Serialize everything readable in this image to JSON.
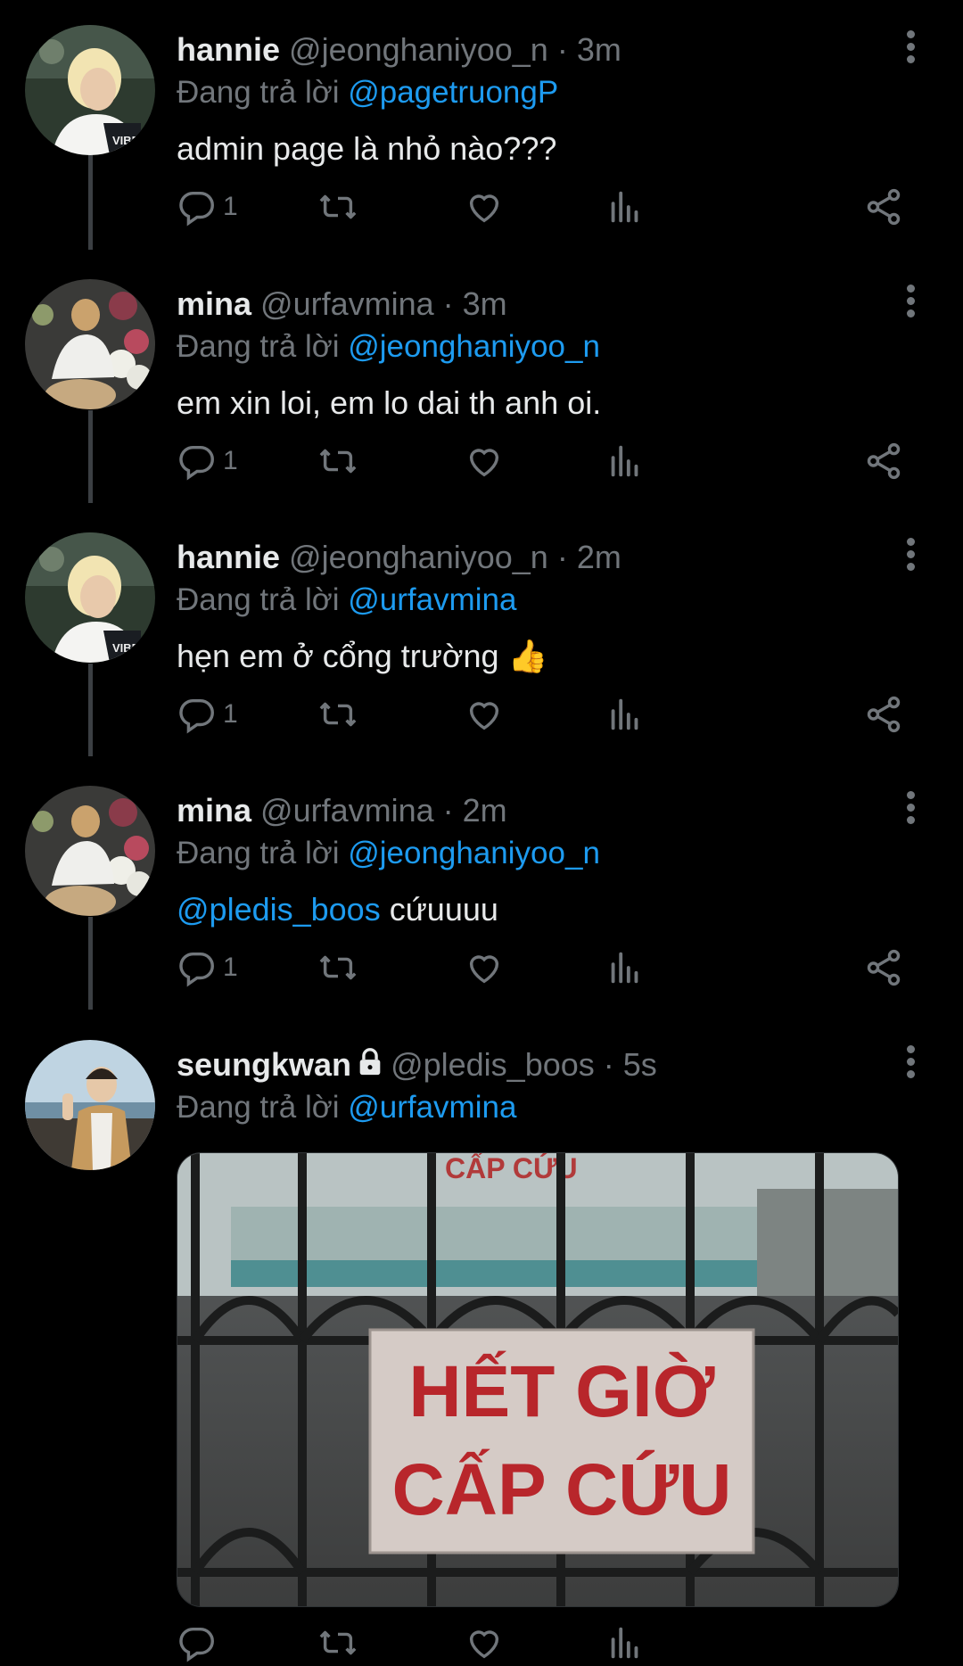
{
  "tweets": [
    {
      "name": "hannie",
      "handle": "@jeonghaniyoo_n",
      "time": "· 3m",
      "reply_prefix": "Đang trả lời",
      "reply_to": "@pagetruongP",
      "text": "admin page là nhỏ nào???",
      "replies": "1"
    },
    {
      "name": "mina",
      "handle": "@urfavmina",
      "time": "· 3m",
      "reply_prefix": "Đang trả lời",
      "reply_to": "@jeonghaniyoo_n",
      "text": "em xin loi, em lo dai th anh oi.",
      "replies": "1"
    },
    {
      "name": "hannie",
      "handle": "@jeonghaniyoo_n",
      "time": "· 2m",
      "reply_prefix": "Đang trả lời",
      "reply_to": "@urfavmina",
      "text": "hẹn em ở cổng trường 👍",
      "replies": "1"
    },
    {
      "name": "mina",
      "handle": "@urfavmina",
      "time": "· 2m",
      "reply_prefix": "Đang trả lời",
      "reply_to": "@jeonghaniyoo_n",
      "text_mention": "@pledis_boos",
      "text": " cứuuuu",
      "replies": "1"
    },
    {
      "name": "seungkwan",
      "handle": "@pledis_boos",
      "time": "· 5s",
      "reply_prefix": "Đang trả lời",
      "reply_to": "@urfavmina",
      "media_sign_line1": "HẾT GIỜ",
      "media_sign_line2": "CẤP CỨU",
      "media_banner": "CẤP CỨU"
    }
  ],
  "colors": {
    "background": "#000000",
    "text": "#e7e9ea",
    "muted": "#71767b",
    "mention": "#1d9bf0",
    "thread_line": "#3b3f43"
  },
  "icons": [
    "reply-icon",
    "retweet-icon",
    "like-icon",
    "views-icon",
    "share-icon",
    "more-icon",
    "lock-icon"
  ]
}
